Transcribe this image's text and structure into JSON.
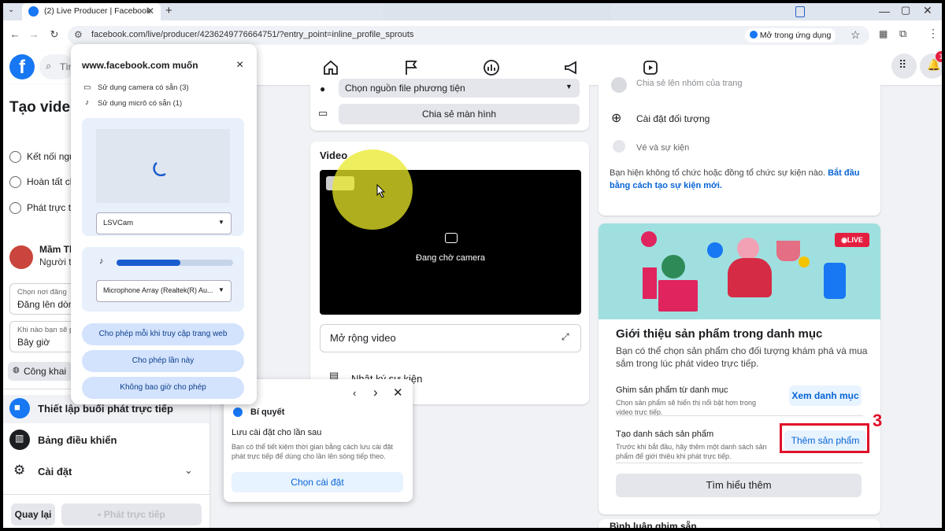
{
  "browser": {
    "tab_title": "(2) Live Producer | Facebook",
    "new_tab": "+",
    "url": "facebook.com/live/producer/4236249776664751/?entry_point=inline_profile_sprouts",
    "open_app": "Mở trong ứng dụng"
  },
  "fb": {
    "logo": "f",
    "search_placeholder": "Tìm"
  },
  "left": {
    "title": "Tạo video",
    "steps": [
      "Kết nối ngu",
      "Hoàn tất cl",
      "Phát trực ti"
    ],
    "profile_name": "Mầm Th",
    "profile_sub": "Người tạ",
    "post_label": "Chọn nơi đăng",
    "post_value": "Đăng lên dòn",
    "when_label": "Khi nào bạn sẽ ph",
    "when_value": "Bây giờ",
    "privacy": "Công khai",
    "menu": [
      "Thiết lập buổi phát trực tiếp",
      "Bảng điều khiển",
      "Cài đặt"
    ],
    "back": "Quay lại",
    "go_live": "Phát trực tiếp"
  },
  "permission": {
    "title": "www.facebook.com muốn",
    "close": "×",
    "camera": "Sử dụng camera có sẵn (3)",
    "mic": "Sử dụng micrô có sẵn (1)",
    "camera_select": "LSVCam",
    "mic_select": "Microphone Array (Realtek(R) Au...",
    "mic_level": 0.55,
    "btn_always": "Cho phép mỗi khi truy cập trang web",
    "btn_once": "Cho phép lần này",
    "btn_never": "Không bao giờ cho phép"
  },
  "middle": {
    "source_select": "Chọn nguồn file phương tiện",
    "share_screen": "Chia sẻ màn hình",
    "video_title": "Video",
    "waiting": "Đang chờ camera",
    "expand": "Mở rộng video",
    "event_log": "Nhật ký sự kiện"
  },
  "tips": {
    "title": "Bí quyết",
    "heading": "Lưu cài đặt cho lần sau",
    "body": "Bạn có thể tiết kiệm thời gian bằng cách lưu cài đặt phát trực tiếp để dùng cho lần lên sóng tiếp theo.",
    "button": "Chọn cài đặt"
  },
  "right": {
    "share_group": "Chia sẻ lên nhóm của trang",
    "audience": "Cài đặt đối tượng",
    "tickets": "Vé và sự kiện",
    "event_note": "Bạn hiện không tổ chức hoặc đồng tổ chức sự kiện nào.",
    "event_link": "Bắt đầu bằng cách tạo sự kiện mới.",
    "live_badge": "LIVE",
    "promo_title": "Giới thiệu sản phẩm trong danh mục",
    "promo_desc": "Bạn có thể chọn sản phẩm cho đối tượng khám phá và mua sắm trong lúc phát video trực tiếp.",
    "pin_title": "Ghim sản phẩm từ danh mục",
    "pin_desc": "Chọn sản phẩm sẽ hiển thị nổi bật hơn trong video trực tiếp.",
    "pin_button": "Xem danh mục",
    "list_title": "Tạo danh sách sản phẩm",
    "list_desc": "Trước khi bắt đầu, hãy thêm một danh sách sản phẩm để giới thiệu khi phát trực tiếp.",
    "list_button": "Thêm sản phẩm",
    "learn_more": "Tìm hiểu thêm",
    "bottom_cut": "Bình luận ghim sẵn"
  },
  "annotation": {
    "step_number": "3",
    "color": "#e0102a"
  },
  "notification_count": "1"
}
